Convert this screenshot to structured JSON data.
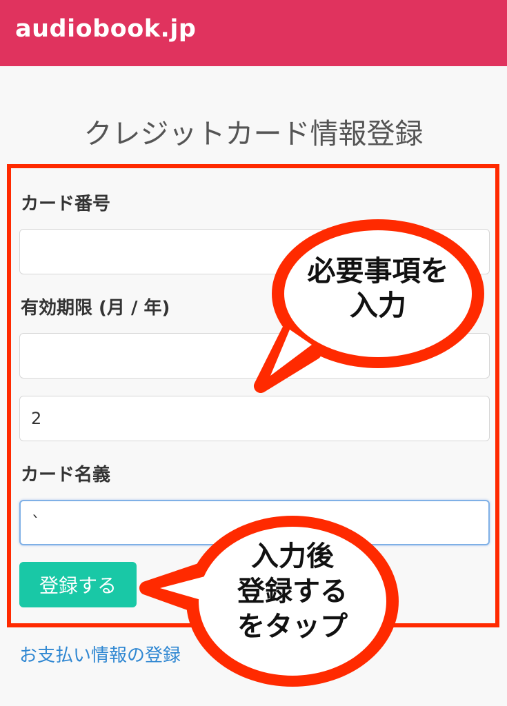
{
  "header": {
    "brand": "audiobook.jp",
    "background_color": "#e0335e"
  },
  "page_title": "クレジットカード情報登録",
  "form": {
    "card_number": {
      "label": "カード番号",
      "value": ""
    },
    "expiry": {
      "label": "有効期限 (月 / 年)",
      "month_value": "",
      "year_value": "2"
    },
    "card_holder": {
      "label": "カード名義",
      "value": "`"
    },
    "submit_label": "登録する",
    "submit_color": "#19c8a6"
  },
  "footer_link": "お支払い情報の登録",
  "annotations": {
    "frame_color": "#ff2a00",
    "bubble_1_lines": [
      "必要事項を",
      "入力"
    ],
    "bubble_2_lines": [
      "入力後",
      "登録する",
      "をタップ"
    ]
  }
}
